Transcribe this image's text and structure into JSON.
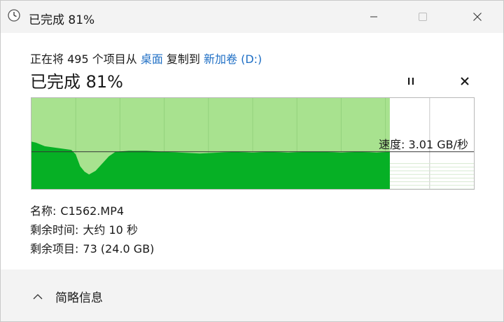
{
  "window": {
    "title": "已完成 81%"
  },
  "copy": {
    "prefix": "正在将 495 个项目从 ",
    "source": "桌面",
    "middle": " 复制到 ",
    "destination": "新加卷 (D:)"
  },
  "status": {
    "headline": "已完成 81%",
    "progress_percent": 81
  },
  "speed": {
    "label": "速度: 3.01 GB/秒",
    "current_fraction_of_max": 0.41
  },
  "details": {
    "name_label": "名称:",
    "name_value": "C1562.MP4",
    "time_label": "剩余时间:",
    "time_value": "大约 10 秒",
    "items_label": "剩余项目:",
    "items_value": "73 (24.0 GB)"
  },
  "footer": {
    "toggle_label": "简略信息"
  },
  "colors": {
    "graph_fill": "#06b025",
    "graph_completed_bg": "#a8e28f",
    "graph_grid": "#c8c8c8",
    "link": "#1f6fc5"
  },
  "icons": {
    "title": "clock-icon",
    "pause": "pause-icon",
    "cancel": "close-icon",
    "toggle": "chevron-up-icon"
  }
}
